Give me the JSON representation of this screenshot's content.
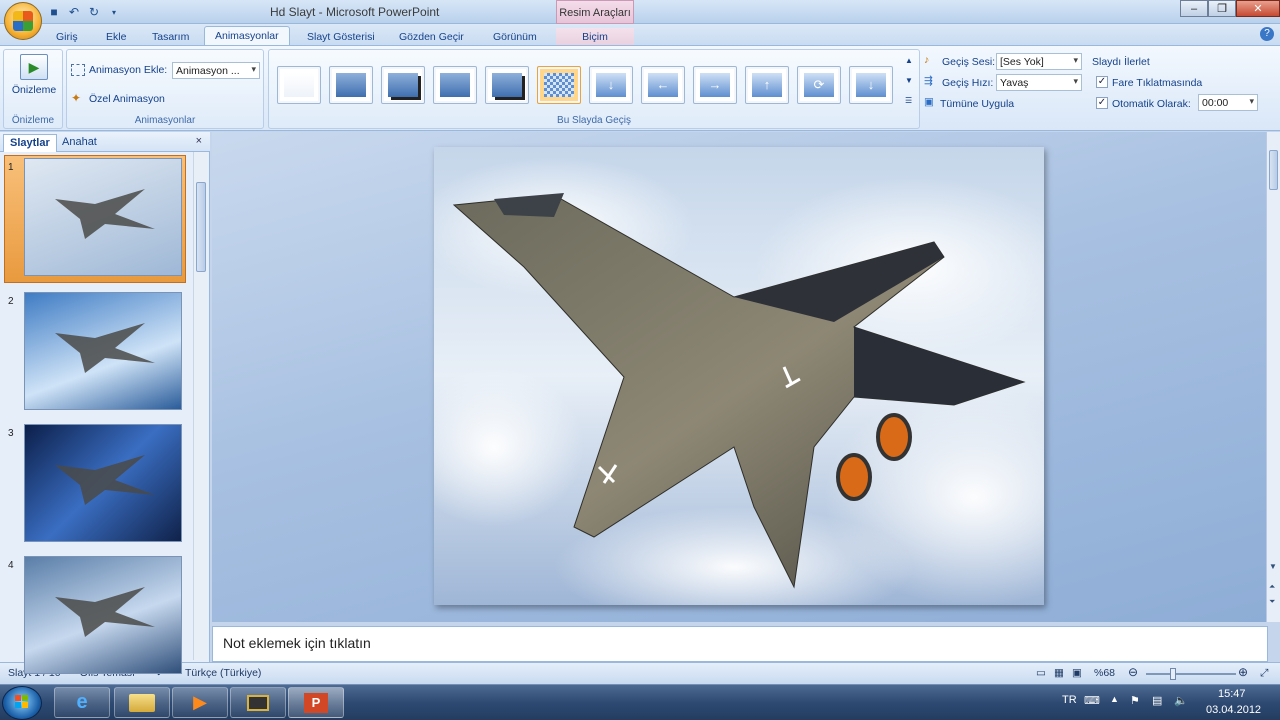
{
  "title_bar": {
    "window_title": "Hd Slayt - Microsoft PowerPoint",
    "contextual_group": "Resim Araçları",
    "quick_access": [
      "save-icon",
      "undo-icon",
      "redo-icon",
      "customize-qat-icon"
    ],
    "controls": [
      "minimize-icon",
      "restore-icon",
      "close-icon"
    ]
  },
  "tabs": [
    {
      "label": "Giriş"
    },
    {
      "label": "Ekle"
    },
    {
      "label": "Tasarım"
    },
    {
      "label": "Animasyonlar",
      "active": true
    },
    {
      "label": "Slayt Gösterisi"
    },
    {
      "label": "Gözden Geçir"
    },
    {
      "label": "Görünüm"
    },
    {
      "label": "Biçim",
      "contextual": true
    }
  ],
  "ribbon": {
    "preview_group": {
      "button": "Önizleme",
      "group_label": "Önizleme"
    },
    "animations_group": {
      "add_animation_label": "Animasyon Ekle:",
      "add_animation_value": "Animasyon ...",
      "custom_animation": "Özel Animasyon",
      "group_label": "Animasyonlar"
    },
    "transition_group": {
      "group_label": "Bu Slayda Geçiş",
      "thumbnails": [
        "no-transition",
        "fade-smoothly",
        "fade-through-black",
        "cut",
        "cut-through-black",
        "dissolve",
        "wipe-down",
        "wipe-left",
        "wipe-right",
        "wipe-up",
        "wheel",
        "cover-down"
      ],
      "selected_index": 5,
      "sound_label": "Geçiş Sesi:",
      "sound_value": "[Ses Yok]",
      "speed_label": "Geçiş Hızı:",
      "speed_value": "Yavaş",
      "apply_all": "Tümüne Uygula"
    },
    "advance_group": {
      "title": "Slaydı İlerlet",
      "on_click_label": "Fare Tıklatmasında",
      "on_click_checked": true,
      "auto_label": "Otomatik Olarak:",
      "auto_checked": true,
      "auto_value": "00:00"
    }
  },
  "slides_pane": {
    "tabs": [
      "Slaytlar",
      "Anahat"
    ],
    "close": "×",
    "slides": [
      {
        "number": "1",
        "selected": true
      },
      {
        "number": "2"
      },
      {
        "number": "3"
      },
      {
        "number": "4"
      }
    ]
  },
  "notes_placeholder": "Not eklemek için tıklatın",
  "status_bar": {
    "slide_info": "Slayt 1 / 10",
    "theme": "\"Ofis Teması\"",
    "language": "Türkçe (Türkiye)",
    "zoom": "%68",
    "zoom_level": 0.68
  },
  "taskbar": {
    "apps": [
      "internet-explorer-icon",
      "file-explorer-icon",
      "media-player-icon",
      "hypercam-icon",
      "powerpoint-icon"
    ],
    "language": "TR",
    "time": "15:47",
    "date": "03.04.2012"
  },
  "colors": {
    "ribbon_blue": "#15428b",
    "selected_thumb": "#ffd68a",
    "slide_bg": "#8eadd6"
  }
}
